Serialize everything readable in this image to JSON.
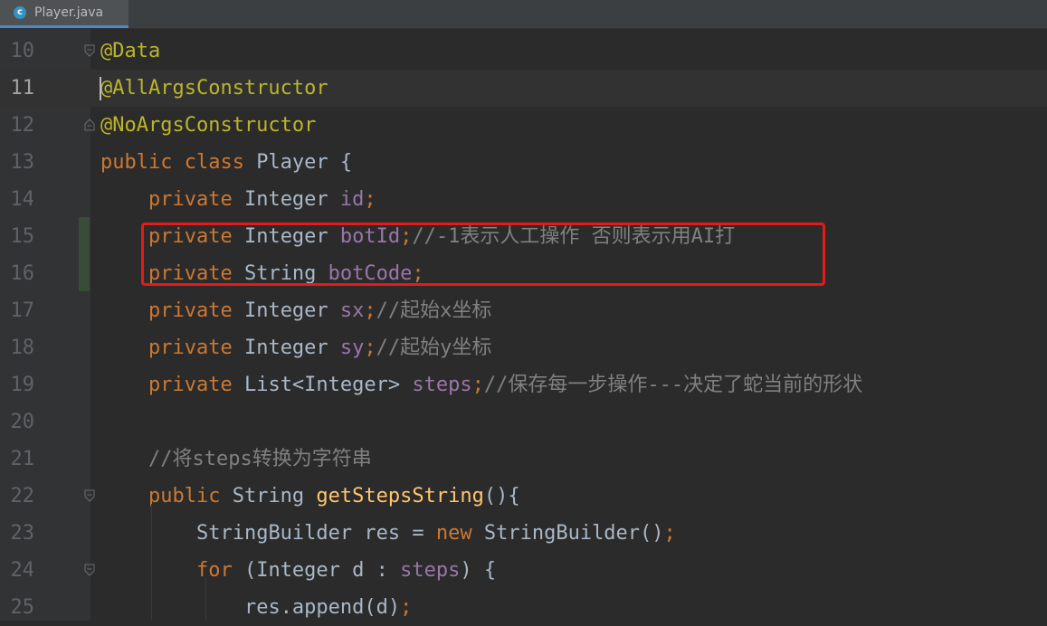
{
  "tab": {
    "icon": "class-icon",
    "icon_letter": "c",
    "label": "Player.java"
  },
  "colors": {
    "background": "#2b2b2b",
    "gutter": "#313335",
    "keyword": "#cc7832",
    "annotation": "#bbb529",
    "field": "#9876aa",
    "comment": "#808080",
    "method": "#ffc66d",
    "plain": "#a9b7c6",
    "highlight_box": "#e31b1b"
  },
  "editor": {
    "current_line": 11,
    "lines": [
      {
        "num": "10",
        "fold": "open",
        "tokens": [
          {
            "t": "@Data",
            "c": "ann"
          }
        ]
      },
      {
        "num": "11",
        "tokens": [
          {
            "t": "@AllArgsConstructor",
            "c": "ann"
          }
        ]
      },
      {
        "num": "12",
        "fold": "close",
        "tokens": [
          {
            "t": "@NoArgsConstructor",
            "c": "ann"
          }
        ]
      },
      {
        "num": "13",
        "tokens": [
          {
            "t": "public class ",
            "c": "kw"
          },
          {
            "t": "Player {",
            "c": "plain"
          }
        ]
      },
      {
        "num": "14",
        "tokens": [
          {
            "t": "    "
          },
          {
            "t": "private ",
            "c": "kw"
          },
          {
            "t": "Integer ",
            "c": "plain"
          },
          {
            "t": "id",
            "c": "field"
          },
          {
            "t": ";",
            "c": "kw"
          }
        ]
      },
      {
        "num": "15",
        "changed": true,
        "tokens": [
          {
            "t": "    "
          },
          {
            "t": "private ",
            "c": "kw"
          },
          {
            "t": "Integer ",
            "c": "plain"
          },
          {
            "t": "botId",
            "c": "field"
          },
          {
            "t": ";",
            "c": "kw"
          },
          {
            "t": "//-1表示人工操作 否则表示用AI打",
            "c": "cmt"
          }
        ]
      },
      {
        "num": "16",
        "changed": true,
        "tokens": [
          {
            "t": "    "
          },
          {
            "t": "private ",
            "c": "kw"
          },
          {
            "t": "String ",
            "c": "plain"
          },
          {
            "t": "botCode",
            "c": "field"
          },
          {
            "t": ";",
            "c": "kw"
          }
        ]
      },
      {
        "num": "17",
        "tokens": [
          {
            "t": "    "
          },
          {
            "t": "private ",
            "c": "kw"
          },
          {
            "t": "Integer ",
            "c": "plain"
          },
          {
            "t": "sx",
            "c": "field"
          },
          {
            "t": ";",
            "c": "kw"
          },
          {
            "t": "//起始x坐标",
            "c": "cmt"
          }
        ]
      },
      {
        "num": "18",
        "tokens": [
          {
            "t": "    "
          },
          {
            "t": "private ",
            "c": "kw"
          },
          {
            "t": "Integer ",
            "c": "plain"
          },
          {
            "t": "sy",
            "c": "field"
          },
          {
            "t": ";",
            "c": "kw"
          },
          {
            "t": "//起始y坐标",
            "c": "cmt"
          }
        ]
      },
      {
        "num": "19",
        "tokens": [
          {
            "t": "    "
          },
          {
            "t": "private ",
            "c": "kw"
          },
          {
            "t": "List<Integer> ",
            "c": "plain"
          },
          {
            "t": "steps",
            "c": "field"
          },
          {
            "t": ";",
            "c": "kw"
          },
          {
            "t": "//保存每一步操作---决定了蛇当前的形状",
            "c": "cmt"
          }
        ]
      },
      {
        "num": "20",
        "tokens": []
      },
      {
        "num": "21",
        "tokens": [
          {
            "t": "    "
          },
          {
            "t": "//将steps转换为字符串",
            "c": "cmt"
          }
        ]
      },
      {
        "num": "22",
        "fold": "open",
        "tokens": [
          {
            "t": "    "
          },
          {
            "t": "public ",
            "c": "kw"
          },
          {
            "t": "String ",
            "c": "plain"
          },
          {
            "t": "getStepsString",
            "c": "fn"
          },
          {
            "t": "(){",
            "c": "plain"
          }
        ]
      },
      {
        "num": "23",
        "tokens": [
          {
            "t": "        "
          },
          {
            "t": "StringBuilder res = ",
            "c": "plain"
          },
          {
            "t": "new ",
            "c": "kw"
          },
          {
            "t": "StringBuilder()",
            "c": "plain"
          },
          {
            "t": ";",
            "c": "kw"
          }
        ]
      },
      {
        "num": "24",
        "fold": "open",
        "tokens": [
          {
            "t": "        "
          },
          {
            "t": "for ",
            "c": "kw"
          },
          {
            "t": "(Integer d : ",
            "c": "plain"
          },
          {
            "t": "steps",
            "c": "field"
          },
          {
            "t": ") {",
            "c": "plain"
          }
        ]
      },
      {
        "num": "25",
        "tokens": [
          {
            "t": "            "
          },
          {
            "t": "res.append(d)",
            "c": "plain"
          },
          {
            "t": ";",
            "c": "kw"
          }
        ]
      }
    ]
  }
}
